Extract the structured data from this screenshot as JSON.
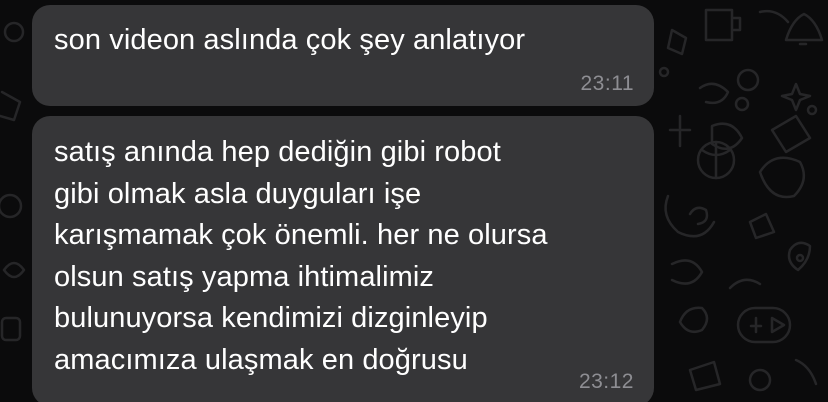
{
  "messages": [
    {
      "text": "son videon aslında çok şey anlatıyor",
      "time": "23:11"
    },
    {
      "text": "satış anında hep dediğin gibi robot\ngibi olmak asla duyguları işe\nkarışmamak çok önemli. her ne olursa\nolsun satış yapma ihtimalimiz\nbulunuyorsa kendimizi dizginleyip\namacımıza ulaşmak en doğrusu",
      "time": "23:12"
    }
  ],
  "colors": {
    "background": "#0b0b0c",
    "bubble": "#363638",
    "text": "#ffffff",
    "timestamp": "#8e8e93",
    "wallpaper_doodle": "#262628"
  }
}
